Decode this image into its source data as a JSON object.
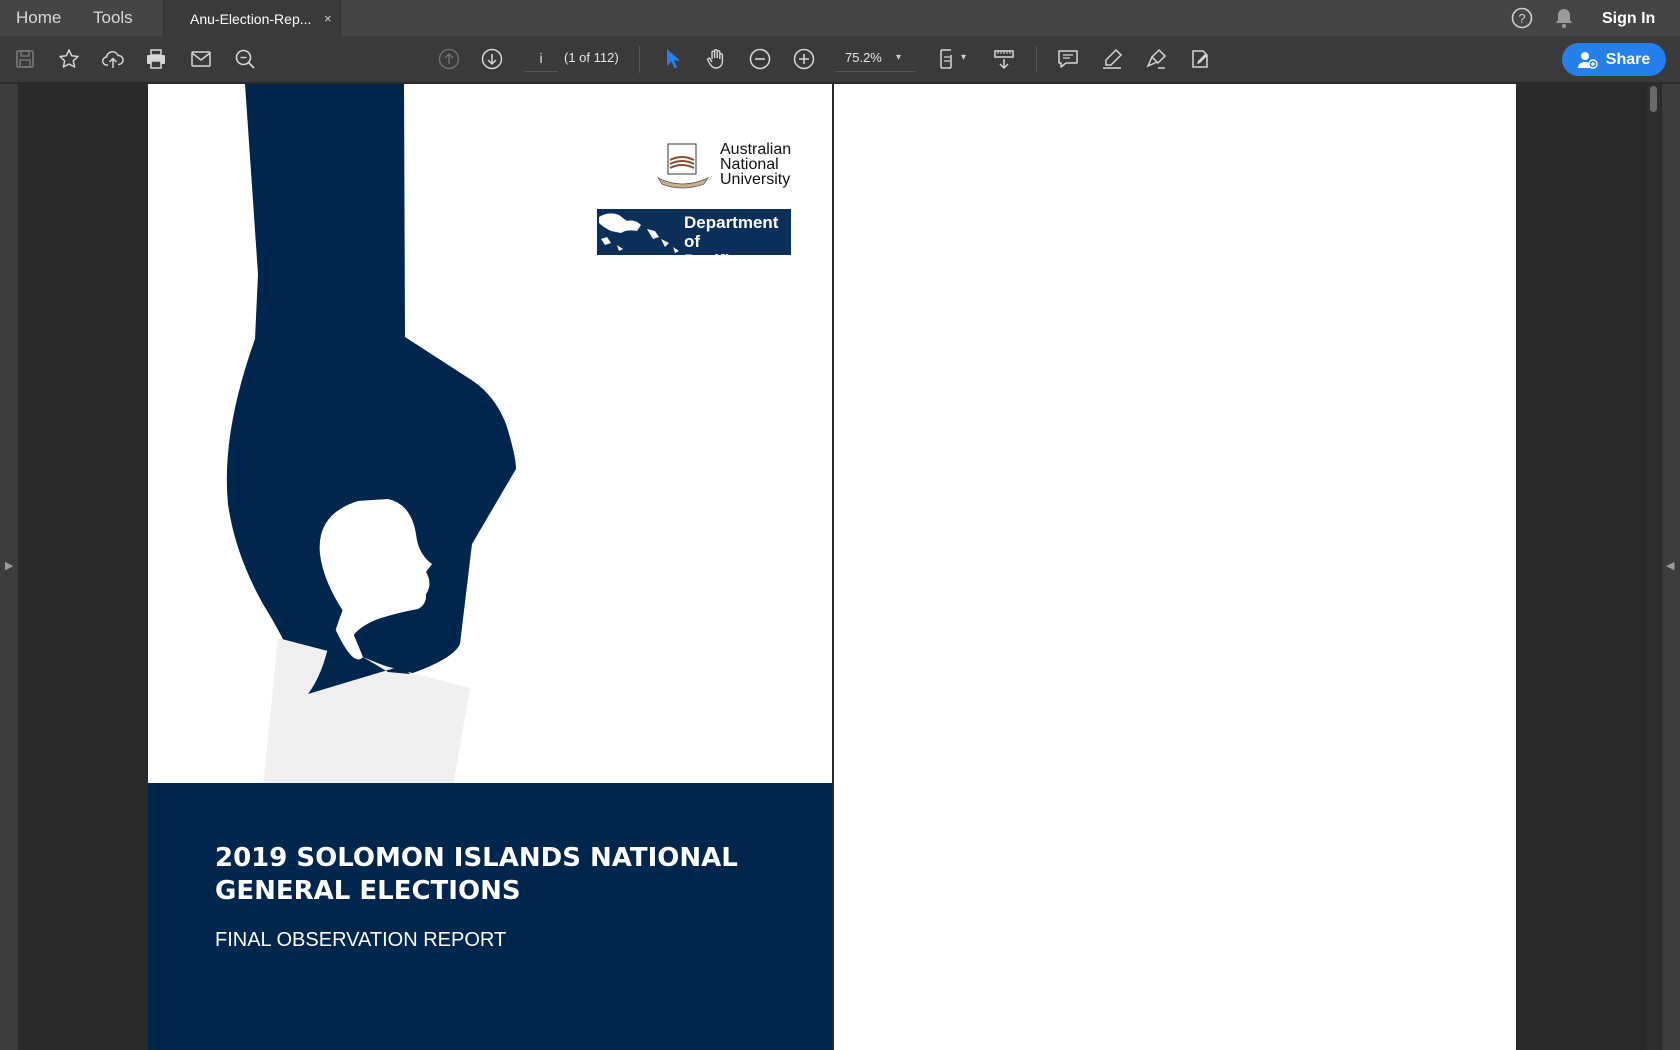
{
  "tabbar": {
    "home": "Home",
    "tools": "Tools",
    "document_tab": "Anu-Election-Rep...",
    "close": "×",
    "sign_in": "Sign In"
  },
  "toolbar": {
    "page_input": "i",
    "page_count": "(1 of 112)",
    "zoom": "75.2%",
    "share": "Share",
    "accent_color": "#2680eb"
  },
  "icons": [
    "save-icon",
    "star-icon",
    "upload-cloud-icon",
    "print-icon",
    "email-icon",
    "search-icon",
    "page-up-icon",
    "page-down-icon",
    "select-arrow-icon",
    "hand-icon",
    "zoom-out-icon",
    "zoom-in-icon",
    "fit-page-icon",
    "scroll-mode-icon",
    "comment-icon",
    "highlight-icon",
    "sign-icon",
    "edit-pdf-icon",
    "help-icon",
    "bell-icon"
  ],
  "document": {
    "anu_logo": "Australian\nNational\nUniversity",
    "dpa_logo": "Department of\nPacific Affairs",
    "title_line1": "2019 SOLOMON ISLANDS NATIONAL",
    "title_line2": "GENERAL ELECTIONS",
    "subtitle": "FINAL OBSERVATION REPORT",
    "cover_color": "#00264d"
  }
}
